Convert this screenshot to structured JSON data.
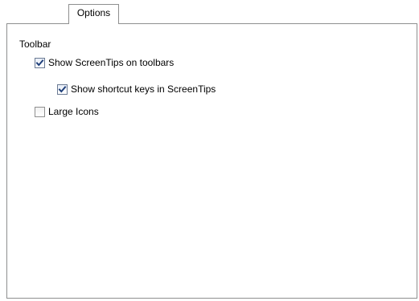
{
  "tabs": [
    {
      "label": "Options",
      "selected": true
    }
  ],
  "toolbar_group": {
    "label": "Toolbar",
    "options": [
      {
        "label": "Show ScreenTips on toolbars",
        "checked": true
      },
      {
        "label": "Show shortcut keys in ScreenTips",
        "checked": true
      },
      {
        "label": "Large Icons",
        "checked": false
      }
    ]
  },
  "colors": {
    "border": "#8e8f8f",
    "check_mark": "#1f3f7a",
    "background": "#ffffff"
  },
  "icons": {
    "checked": "checkmark-icon"
  }
}
